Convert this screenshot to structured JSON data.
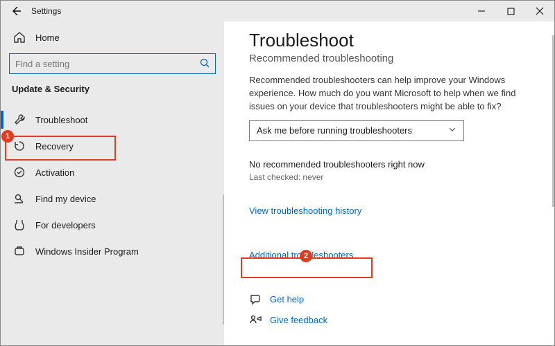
{
  "titlebar": {
    "title": "Settings"
  },
  "sidebar": {
    "home": "Home",
    "search_placeholder": "Find a setting",
    "category": "Update & Security",
    "items": [
      {
        "label": "Troubleshoot"
      },
      {
        "label": "Recovery"
      },
      {
        "label": "Activation"
      },
      {
        "label": "Find my device"
      },
      {
        "label": "For developers"
      },
      {
        "label": "Windows Insider Program"
      }
    ]
  },
  "content": {
    "heading": "Troubleshoot",
    "subheading": "Recommended troubleshooting",
    "description": "Recommended troubleshooters can help improve your Windows experience. How much do you want Microsoft to help when we find issues on your device that troubleshooters might be able to fix?",
    "dropdown_value": "Ask me before running troubleshooters",
    "status": "No recommended troubleshooters right now",
    "last_checked_label": "Last checked:",
    "last_checked_value": "never",
    "history_link": "View troubleshooting history",
    "additional_link": "Additional troubleshooters",
    "get_help": "Get help",
    "give_feedback": "Give feedback"
  },
  "annotations": {
    "step1": "1",
    "step2": "2"
  }
}
